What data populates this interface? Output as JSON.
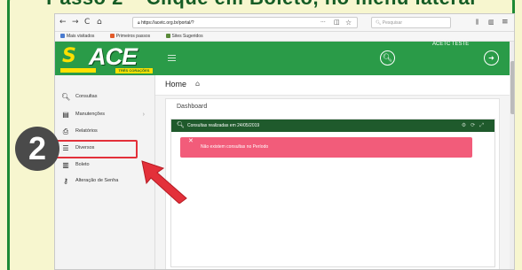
{
  "banner": {
    "text": "Passo 2 – Clique em Boleto, no menu lateral"
  },
  "browser": {
    "url_prefix": "https://acetc.",
    "url_domain": "acetc.org.br",
    "url_full": "https://acetc.org.br/portal/?",
    "search_placeholder": "Pesquisar",
    "nav": {
      "back": "←",
      "forward": "→",
      "reload": "C",
      "home": "⌂"
    },
    "actions": {
      "more": "···",
      "pocket": "◫",
      "star": "☆",
      "library": "⫼",
      "reader": "▥",
      "menu": "≡"
    },
    "bookmarks": [
      {
        "label": "Mais visitados",
        "color": "#4a7bd0"
      },
      {
        "label": "Primeiros passos",
        "color": "#e25b2a"
      },
      {
        "label": "Sites Sugeridos",
        "color": "#5a8a3a"
      }
    ]
  },
  "app": {
    "logo_text": "ACE",
    "logo_city": "TRÊS CORAÇÕES",
    "user_name": "ACETC TESTE",
    "breadcrumb_home": "Home",
    "dashboard_title": "Dashboard",
    "panel_title": "Consultas realizadas em 24/05/2019",
    "alert_message": "Não existem consultas no Período",
    "sidebar": [
      {
        "label": "Consultas",
        "icon": "search-icon",
        "glyph": "🔍︎",
        "has_chevron": false
      },
      {
        "label": "Manutenções",
        "icon": "database-icon",
        "glyph": "▤",
        "has_chevron": true
      },
      {
        "label": "Relatórios",
        "icon": "print-icon",
        "glyph": "⎙",
        "has_chevron": false
      },
      {
        "label": "Diversos",
        "icon": "list-icon",
        "glyph": "☰",
        "has_chevron": false
      },
      {
        "label": "Boleto",
        "icon": "barcode-icon",
        "glyph": "▥",
        "has_chevron": false
      },
      {
        "label": "Alteração de Senha",
        "icon": "key-icon",
        "glyph": "⚷",
        "has_chevron": false
      }
    ]
  },
  "annotation": {
    "step_number": "2",
    "highlight_color": "#e3303a",
    "arrow_color": "#e3303a"
  },
  "colors": {
    "brand_green": "#2a9b48",
    "panel_dark": "#1f5a2c",
    "alert_pink": "#f25c7a",
    "frame_green": "#1d8a35",
    "background": "#f7f6cf"
  }
}
